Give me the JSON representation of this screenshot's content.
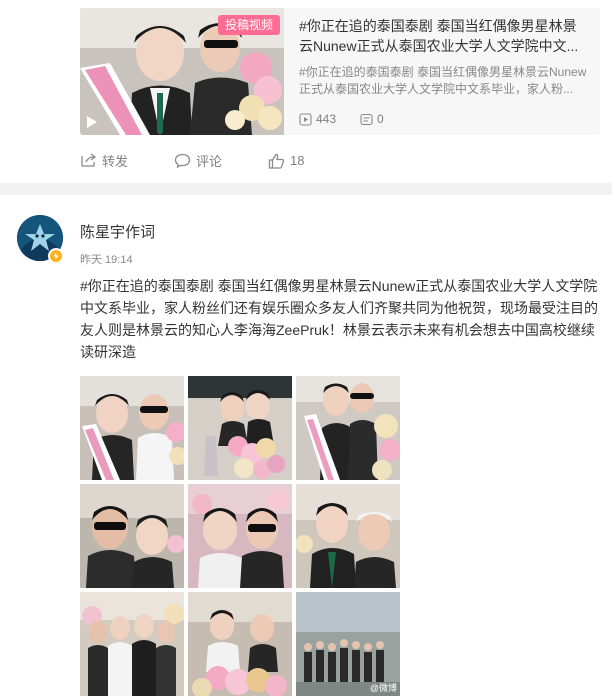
{
  "repost": {
    "thumb_tag": "投稿视频",
    "title": "#你正在追的泰国泰剧 泰国当红偶像男星林景云Nunew正式从泰国农业大学人文学院中文...",
    "desc": "#你正在追的泰国泰剧 泰国当红偶像男星林景云Nunew正式从泰国农业大学人文学院中文系毕业，家人粉...",
    "views": "443",
    "comments": "0"
  },
  "actions": {
    "share_label": "转发",
    "comment_label": "评论",
    "like_count": "18"
  },
  "post": {
    "author": "陈星宇作词",
    "time": "昨天 19:14",
    "text": "#你正在追的泰国泰剧 泰国当红偶像男星林景云Nunew正式从泰国农业大学人文学院中文系毕业，家人粉丝们还有娱乐圈众多友人们齐聚共同为他祝贺，现场最受注目的友人则是林景云的知心人李海海ZeePruk！林景云表示未来有机会想去中国高校继续读研深造",
    "watermark": "@微博"
  },
  "colors": {
    "tag_pink": "#ff6c93",
    "badge_gold": "#ffb11b",
    "divider": "#f2f2f2",
    "meta_gray": "#808080"
  },
  "icons": [
    "play-icon",
    "views-icon",
    "comment-icon",
    "share-icon",
    "like-icon",
    "verified-badge-icon"
  ]
}
